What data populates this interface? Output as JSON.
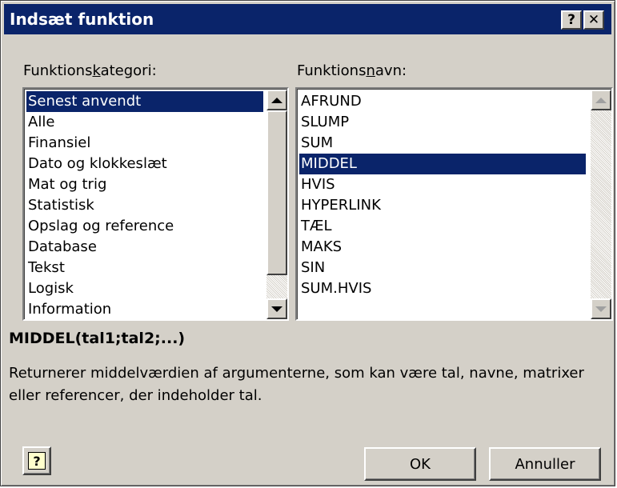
{
  "dialog": {
    "title": "Indsæt funktion",
    "help_button": "?",
    "close_button": "✕"
  },
  "category": {
    "label_before": "Funktions",
    "label_accel": "k",
    "label_after": "ategori:",
    "items": [
      "Senest anvendt",
      "Alle",
      "Finansiel",
      "Dato og klokkeslæt",
      "Mat og trig",
      "Statistisk",
      "Opslag og reference",
      "Database",
      "Tekst",
      "Logisk",
      "Information"
    ],
    "selected": "Senest anvendt"
  },
  "function": {
    "label_before": "Funktions",
    "label_accel": "n",
    "label_after": "avn:",
    "items": [
      "AFRUND",
      "SLUMP",
      "SUM",
      "MIDDEL",
      "HVIS",
      "HYPERLINK",
      "TÆL",
      "MAKS",
      "SIN",
      "SUM.HVIS"
    ],
    "selected": "MIDDEL"
  },
  "syntax": "MIDDEL(tal1;tal2;...)",
  "description": "Returnerer middelværdien af argumenterne, som kan være tal, navne, matrixer eller referencer, der indeholder tal.",
  "buttons": {
    "help_icon": "?",
    "ok": "OK",
    "cancel": "Annuller"
  },
  "colors": {
    "titlebar": "#0a246a",
    "selection": "#0a246a",
    "face": "#d4d0c8"
  }
}
